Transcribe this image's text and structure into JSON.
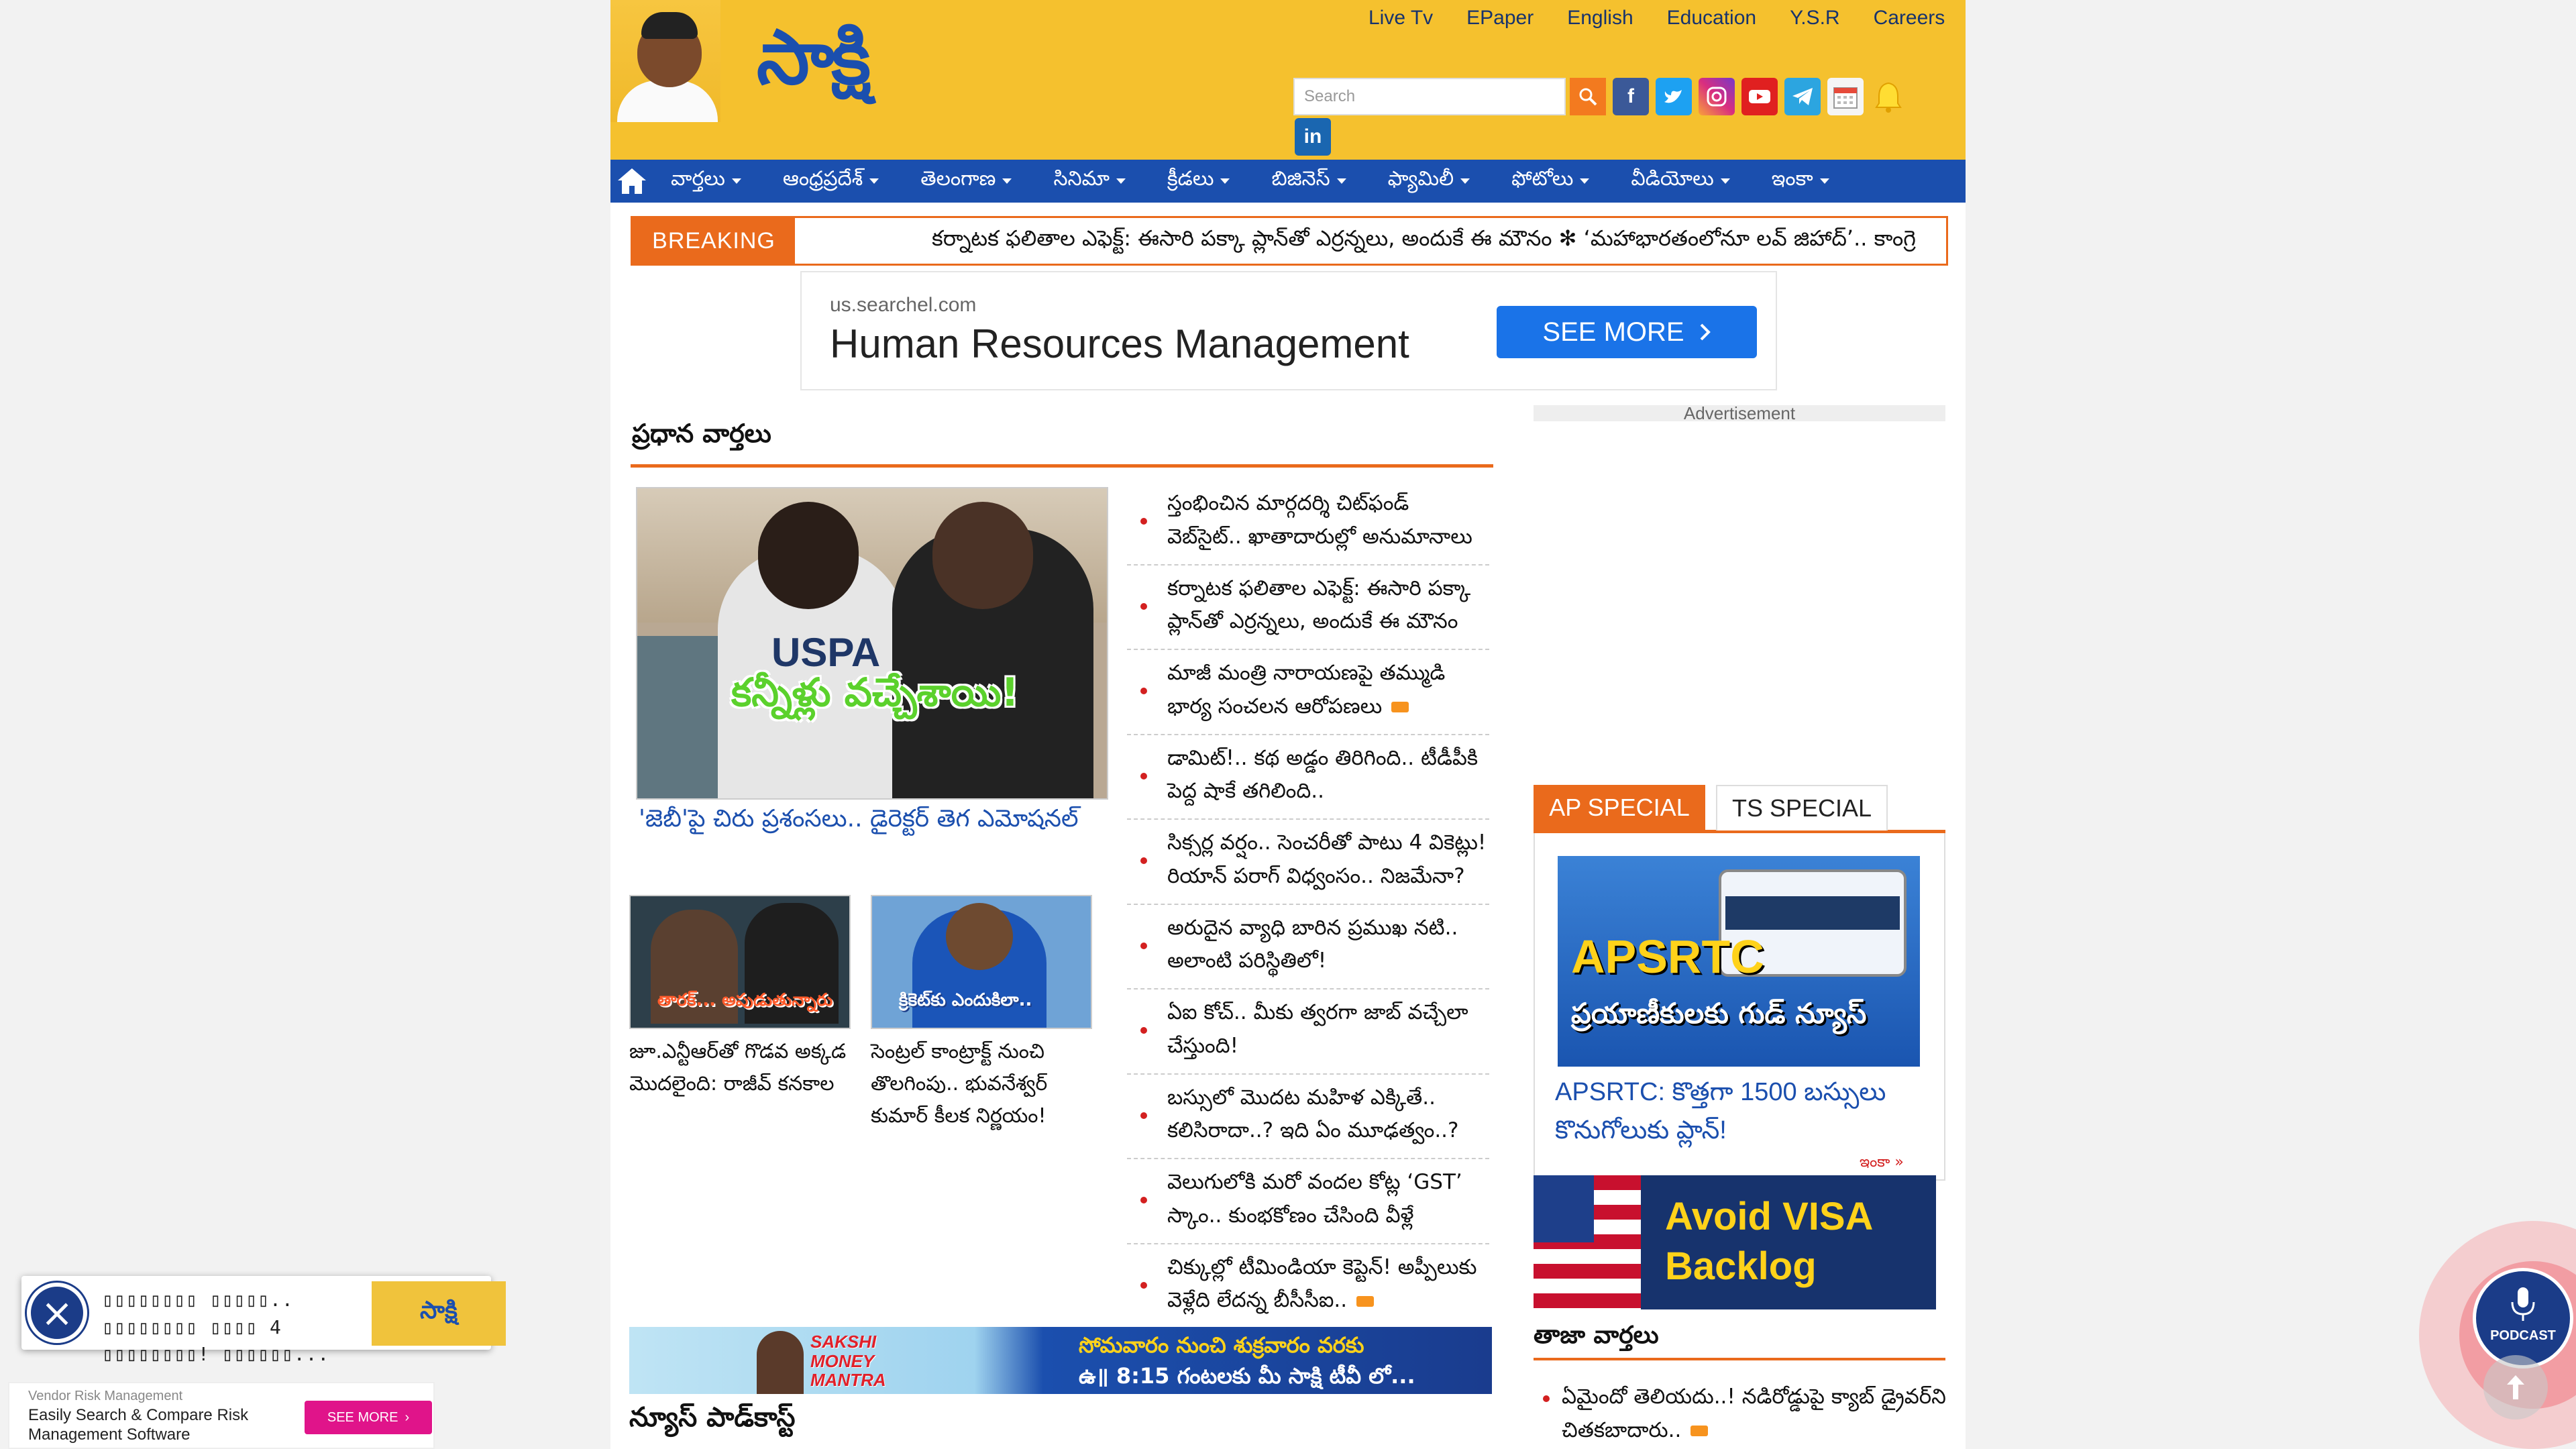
{
  "header": {
    "logo_text": "సాక్షి",
    "top_links": [
      "Live Tv",
      "EPaper",
      "English",
      "Education",
      "Y.S.R",
      "Careers"
    ],
    "search_placeholder": "Search",
    "social_icons": [
      "facebook-icon",
      "twitter-icon",
      "instagram-icon",
      "youtube-icon",
      "telegram-icon",
      "calendar-icon",
      "notification-bell-icon",
      "linkedin-icon"
    ]
  },
  "nav": {
    "items": [
      "వార్తలు",
      "ఆంధ్రప్రదేశ్",
      "తెలంగాణ",
      "సినిమా",
      "క్రీడలు",
      "బిజినెస్",
      "ఫ్యామిలీ",
      "ఫోటోలు",
      "వీడియోలు",
      "ఇంకా"
    ]
  },
  "breaking": {
    "label": "BREAKING",
    "text": "కర్నాటక ఫలితాల ఎఫెక్ట్‌: ఈసారి పక్కా ప్లాన్‌తో ఎర్రన్నలు, అందుకే ఈ మౌనం   ✻   ‘మహాభారతంలోనూ లవ్‌ జిహాద్‌’.. కాంగ్రె"
  },
  "ad": {
    "url": "us.searchel.com",
    "title": "Human Resources Management",
    "button": "SEE MORE"
  },
  "main": {
    "section_title": "ప్రధాన వార్తలు",
    "hero_overlay": "కన్నీళ్లు వచ్చేశాయి!",
    "hero_shirt": "USPA",
    "hero_caption": "'జెబీ'పై చిరు ప్రశంసలు.. డైరెక్టర్‌ తెగ ఎమోషనల్‌",
    "thumbs": [
      {
        "overlay": "తారక్... అపుడుతున్నారు",
        "caption": "జూ.ఎన్టీఆర్‌తో గొడవ అక్కడ మొదలైంది: రాజీవ్‌ కనకాల"
      },
      {
        "overlay": "క్రికెట్‌కు ఎందుకిలా..",
        "caption": "సెంట్రల్‌ కాంట్రాక్ట్‌ నుంచి తొలగింపు.. భువనేశ్వర్‌ కుమార్‌ కీలక నిర్ణయం!"
      }
    ],
    "list": [
      {
        "text": "స్తంభించిన మార్గదర్శి చిట్‌ఫండ్‌ వెబ్‌సైట్‌.. ఖాతాదారుల్లో అనుమానాలు",
        "video": false
      },
      {
        "text": "కర్నాటక ఫలితాల ఎఫెక్ట్‌: ఈసారి పక్కా ప్లాన్‌తో ఎర్రన్నలు, అందుకే ఈ మౌనం",
        "video": false
      },
      {
        "text": "మాజీ మంత్రి నారాయణపై తమ్ముడి భార్య సంచలన ఆరోపణలు",
        "video": true
      },
      {
        "text": "డామిట్‌!.. కథ అడ్డం తిరిగింది.. టీడీపీకి పెద్ద షాకే తగిలింది..",
        "video": false
      },
      {
        "text": "సిక్సర్ల వర్షం.. సెంచరీతో పాటు 4 వికెట్లు! రియాన్‌ పరాగ్‌ విధ్వంసం.. నిజమేనా?",
        "video": false
      },
      {
        "text": "అరుదైన వ్యాధి బారిన ప్రముఖ నటి.. అలాంటి పరిస్థితిలో!",
        "video": false
      },
      {
        "text": "ఏఐ కోచ్‌.. మీకు త్వరగా జాబ్‌ వచ్చేలా చేస్తుంది!",
        "video": false
      },
      {
        "text": "బస్సులో మొదట మహిళ ఎక్కితే.. కలిసిరాదా..? ఇది ఏం మూఢత్వం..?",
        "video": false
      },
      {
        "text": "వెలుగులోకి మరో వందల కోట్ల ‘GST’ స్కాం.. కుంభకోణం చేసింది వీళ్లే",
        "video": false
      },
      {
        "text": "చిక్కుల్లో టీమిండియా కెప్టెన్‌! అప్పీలుకు వెళ్లేది లేదన్న బీసీసీఐ..",
        "video": true
      }
    ],
    "banner": {
      "brand": "SAKSHI MONEY MANTRA",
      "line1": "సోమవారం నుంచి శుక్రవారం వరకు",
      "line2": "ఉ॥ 8:15 గంటలకు మీ సాక్షి టీవీ లో..."
    },
    "podcast_title": "న్యూస్‌ పాడ్‌కాస్ట్‌"
  },
  "sidebar": {
    "ad_label": "Advertisement",
    "tabs": [
      "AP SPECIAL",
      "TS SPECIAL"
    ],
    "special": {
      "image_text": "APSRTC",
      "image_subtext": "ప్రయాణీకులకు గుడ్‌ న్యూస్‌",
      "caption": "APSRTC: కొత్తగా 1500 బస్సులు కొనుగోలుకు ప్లాన్‌!",
      "more": "ఇంకా »"
    },
    "visa_ad": {
      "line1": "Avoid VISA",
      "line2": "Backlog"
    },
    "taja_title": "తాజా వార్తలు",
    "taja_items": [
      {
        "text": "ఏమైందో తెలియదు..! నడిరోడ్డుపై క్యాబ్‌ డ్రైవర్‌ని చితకబాదారు..",
        "video": true
      }
    ]
  },
  "notification": {
    "text": "▯▯▯▯▯▯▯▯ ▯▯▯▯▯.. ▯▯▯▯▯▯▯▯ ▯▯▯▯ 4 ▯▯▯▯▯▯▯▯! ▯▯▯▯▯▯...",
    "image_text": "సాక్షి"
  },
  "vendor_ad": {
    "source": "Vendor Risk Management",
    "text": "Easily Search & Compare Risk Management Software",
    "button": "SEE MORE"
  },
  "podcast_button": {
    "label": "PODCAST"
  }
}
